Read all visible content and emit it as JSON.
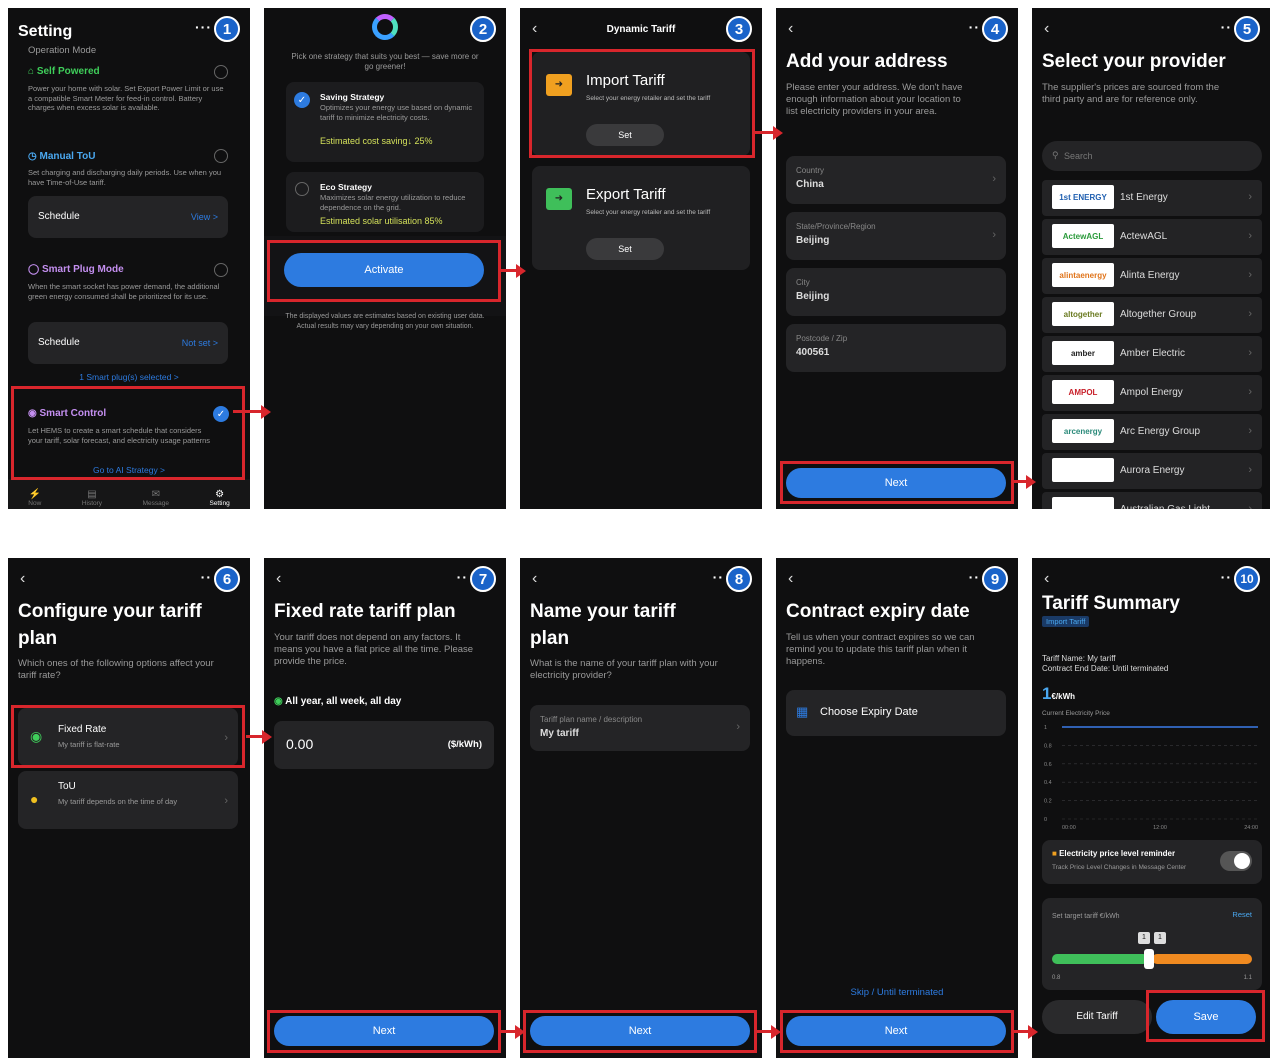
{
  "p1": {
    "title": "Setting",
    "badge": "1",
    "menu_icon": "more-dots",
    "section": "Operation Mode",
    "self_powered": {
      "title": "Self Powered",
      "desc": "Power your home with solar. Set Export Power Limit or use a compatible Smart Meter for feed-in control. Battery charges when excess solar is available."
    },
    "manual_tou": {
      "title": "Manual ToU",
      "desc": "Set charging and discharging daily periods. Use when you have Time-of-Use tariff.",
      "schedule_label": "Schedule",
      "schedule_value": "View >"
    },
    "smart_plug": {
      "title": "Smart Plug Mode",
      "desc": "When the smart socket has power demand, the additional green energy consumed shall be prioritized for its use.",
      "schedule_label": "Schedule",
      "schedule_value": "Not set >",
      "selected": "1 Smart plug(s) selected  >"
    },
    "smart_control": {
      "title": "Smart Control",
      "desc": "Let HEMS to create a smart schedule that considers your tariff, solar forecast, and electricity usage patterns",
      "link": "Go to AI Strategy  >"
    },
    "nav": [
      "Now",
      "History",
      "Message",
      "Setting"
    ]
  },
  "p2": {
    "badge": "2",
    "intro": "Pick one strategy that suits you best — save more or go greener!",
    "saving": {
      "title": "Saving Strategy",
      "desc": "Optimizes your energy use based on dynamic tariff to minimize electricity costs.",
      "metric": "Estimated cost saving↓ 25%"
    },
    "eco": {
      "title": "Eco Strategy",
      "desc": "Maximizes solar energy utilization to reduce dependence on the grid.",
      "metric": "Estimated solar utilisation 85%"
    },
    "activate": "Activate",
    "note": "The displayed values are estimates based on existing user data. Actual results may vary depending on your own situation."
  },
  "p3": {
    "title": "Dynamic Tariff",
    "badge": "3",
    "import": {
      "title": "Import Tariff",
      "desc": "Select your energy retailer and set the tariff",
      "button": "Set"
    },
    "export": {
      "title": "Export Tariff",
      "desc": "Select your energy retailer and set the tariff",
      "button": "Set"
    }
  },
  "p4": {
    "badge": "4",
    "title": "Add your address",
    "desc": "Please enter your address. We don't have enough information about your location to list electricity providers in your area.",
    "fields": [
      {
        "label": "Country",
        "value": "China"
      },
      {
        "label": "State/Province/Region",
        "value": "Beijing"
      },
      {
        "label": "City",
        "value": "Beijing"
      },
      {
        "label": "Postcode / Zip",
        "value": "400561"
      }
    ],
    "next": "Next"
  },
  "p5": {
    "badge": "5",
    "title": "Select your provider",
    "desc": "The supplier's prices are sourced from the third party and are for reference only.",
    "search_placeholder": "Search",
    "providers": [
      {
        "name": "1st Energy",
        "logo": "1st ENERGY",
        "color": "#1f5fb0"
      },
      {
        "name": "ActewAGL",
        "logo": "ActewAGL",
        "color": "#2a9a3a"
      },
      {
        "name": "Alinta Energy",
        "logo": "alintaenergy",
        "color": "#e0741a"
      },
      {
        "name": "Altogether Group",
        "logo": "altogether",
        "color": "#6a7a20"
      },
      {
        "name": "Amber Electric",
        "logo": "amber",
        "color": "#222222"
      },
      {
        "name": "Ampol Energy",
        "logo": "AMPOL",
        "color": "#c8202a"
      },
      {
        "name": "Arc Energy Group",
        "logo": "arcenergy",
        "color": "#2a8a7a"
      },
      {
        "name": "Aurora Energy",
        "logo": "",
        "color": "#ffffff"
      },
      {
        "name": "Australian Gas Light",
        "logo": "",
        "color": "#1f5fb0"
      }
    ]
  },
  "p6": {
    "badge": "6",
    "title": "Configure your tariff plan",
    "desc": "Which ones of the following options affect your tariff rate?",
    "options": [
      {
        "title": "Fixed Rate",
        "desc": "My tariff is flat-rate"
      },
      {
        "title": "ToU",
        "desc": "My tariff depends on the time of day"
      }
    ]
  },
  "p7": {
    "badge": "7",
    "title": "Fixed rate tariff plan",
    "desc": "Your tariff does not depend on any factors. It means you have a flat price all the time. Please provide the price.",
    "period": "All year, all week, all day",
    "value": "0.00",
    "unit": "($/kWh)",
    "next": "Next"
  },
  "p8": {
    "badge": "8",
    "title": "Name your tariff plan",
    "desc": "What is the name of your tariff plan with your electricity provider?",
    "field_label": "Tariff plan name / description",
    "field_value": "My tariff",
    "next": "Next"
  },
  "p9": {
    "badge": "9",
    "title": "Contract expiry date",
    "desc": "Tell us when your contract expires so we can remind you to update this tariff plan when it happens.",
    "choose": "Choose Expiry Date",
    "skip": "Skip / Until terminated",
    "next": "Next"
  },
  "p10": {
    "badge": "10",
    "title": "Tariff Summary",
    "tag": "Import Tariff",
    "name_line": "Tariff Name: My tariff",
    "end_line": "Contract End Date: Until terminated",
    "price": "1",
    "price_unit": "€/kWh",
    "price_label": "Current Electricity Price",
    "reminder_title": "Electricity price level reminder",
    "reminder_desc": "Track Price Level Changes in Message Center",
    "target_label": "Set target tariff €/kWh",
    "reset": "Reset",
    "slider_values": [
      "1",
      "1"
    ],
    "slider_min": "0.8",
    "slider_max": "1.1",
    "edit": "Edit Tariff",
    "save": "Save"
  },
  "chart_data": {
    "type": "line",
    "x": [
      "00:00",
      "12:00",
      "24:00"
    ],
    "yticks": [
      "1",
      "0.8",
      "0.6",
      "0.4",
      "0.2",
      "0"
    ],
    "series": [
      {
        "values": [
          1,
          1,
          1
        ]
      }
    ],
    "ylim": [
      0,
      1
    ]
  }
}
